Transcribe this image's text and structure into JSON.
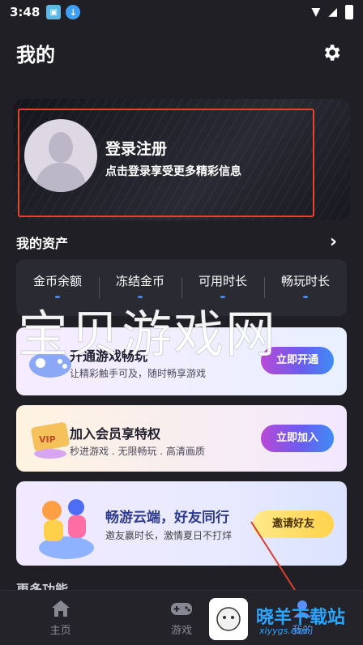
{
  "status_bar": {
    "time": "3:48"
  },
  "header": {
    "title": "我的"
  },
  "profile": {
    "title": "登录注册",
    "subtitle": "点击登录享受更多精彩信息"
  },
  "assets": {
    "title": "我的资产",
    "items": [
      {
        "label": "金币余额"
      },
      {
        "label": "冻结金币"
      },
      {
        "label": "可用时长"
      },
      {
        "label": "畅玩时长"
      }
    ]
  },
  "promos": [
    {
      "title": "开通游戏畅玩",
      "subtitle": "让精彩触手可及，随时畅享游戏",
      "button": "立即开通"
    },
    {
      "title": "加入会员享特权",
      "subtitle": "秒进游戏 . 无限畅玩 . 高清画质",
      "button": "立即加入"
    },
    {
      "title": "畅游云端，好友同行",
      "subtitle": "邀友赢时长，激情夏日不打烊",
      "button": "邀请好友"
    }
  ],
  "more": {
    "title": "更多功能"
  },
  "watermark": "宝贝游戏网",
  "bottom_nav": [
    {
      "label": "主页"
    },
    {
      "label": "游戏"
    },
    {
      "label": "我的"
    }
  ],
  "site_logo": {
    "text": "晓羊下载站",
    "url": "xiyygs.com"
  },
  "colors": {
    "accent": "#5a8df5",
    "background": "#1f1f25",
    "highlight_border": "#e8412c"
  }
}
